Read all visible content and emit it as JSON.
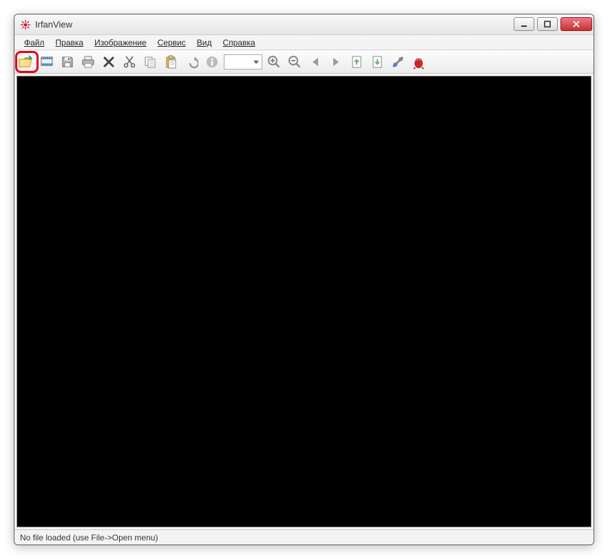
{
  "window": {
    "title": "IrfanView"
  },
  "menu": {
    "items": [
      {
        "label": "Файл"
      },
      {
        "label": "Правка"
      },
      {
        "label": "Изображение"
      },
      {
        "label": "Сервис"
      },
      {
        "label": "Вид"
      },
      {
        "label": "Справка"
      }
    ]
  },
  "toolbar": {
    "zoom_value": "",
    "buttons": [
      {
        "name": "open",
        "icon": "folder-open-icon"
      },
      {
        "name": "slideshow",
        "icon": "slideshow-icon"
      },
      {
        "name": "save",
        "icon": "diskette-icon"
      },
      {
        "name": "print",
        "icon": "printer-icon"
      },
      {
        "name": "delete",
        "icon": "delete-x-icon"
      },
      {
        "name": "cut",
        "icon": "scissors-icon"
      },
      {
        "name": "copy",
        "icon": "copy-icon"
      },
      {
        "name": "paste",
        "icon": "clipboard-paste-icon"
      },
      {
        "name": "undo",
        "icon": "undo-icon"
      },
      {
        "name": "info",
        "icon": "info-icon"
      },
      {
        "name": "zoom-in",
        "icon": "zoom-in-icon"
      },
      {
        "name": "zoom-out",
        "icon": "zoom-out-icon"
      },
      {
        "name": "prev",
        "icon": "arrow-left-icon"
      },
      {
        "name": "next",
        "icon": "arrow-right-icon"
      },
      {
        "name": "prev-page",
        "icon": "page-up-icon"
      },
      {
        "name": "next-page",
        "icon": "page-down-icon"
      },
      {
        "name": "settings",
        "icon": "wrench-icon"
      },
      {
        "name": "about",
        "icon": "irfan-mascot-icon"
      }
    ]
  },
  "status": {
    "text": "No file loaded (use File->Open menu)"
  }
}
